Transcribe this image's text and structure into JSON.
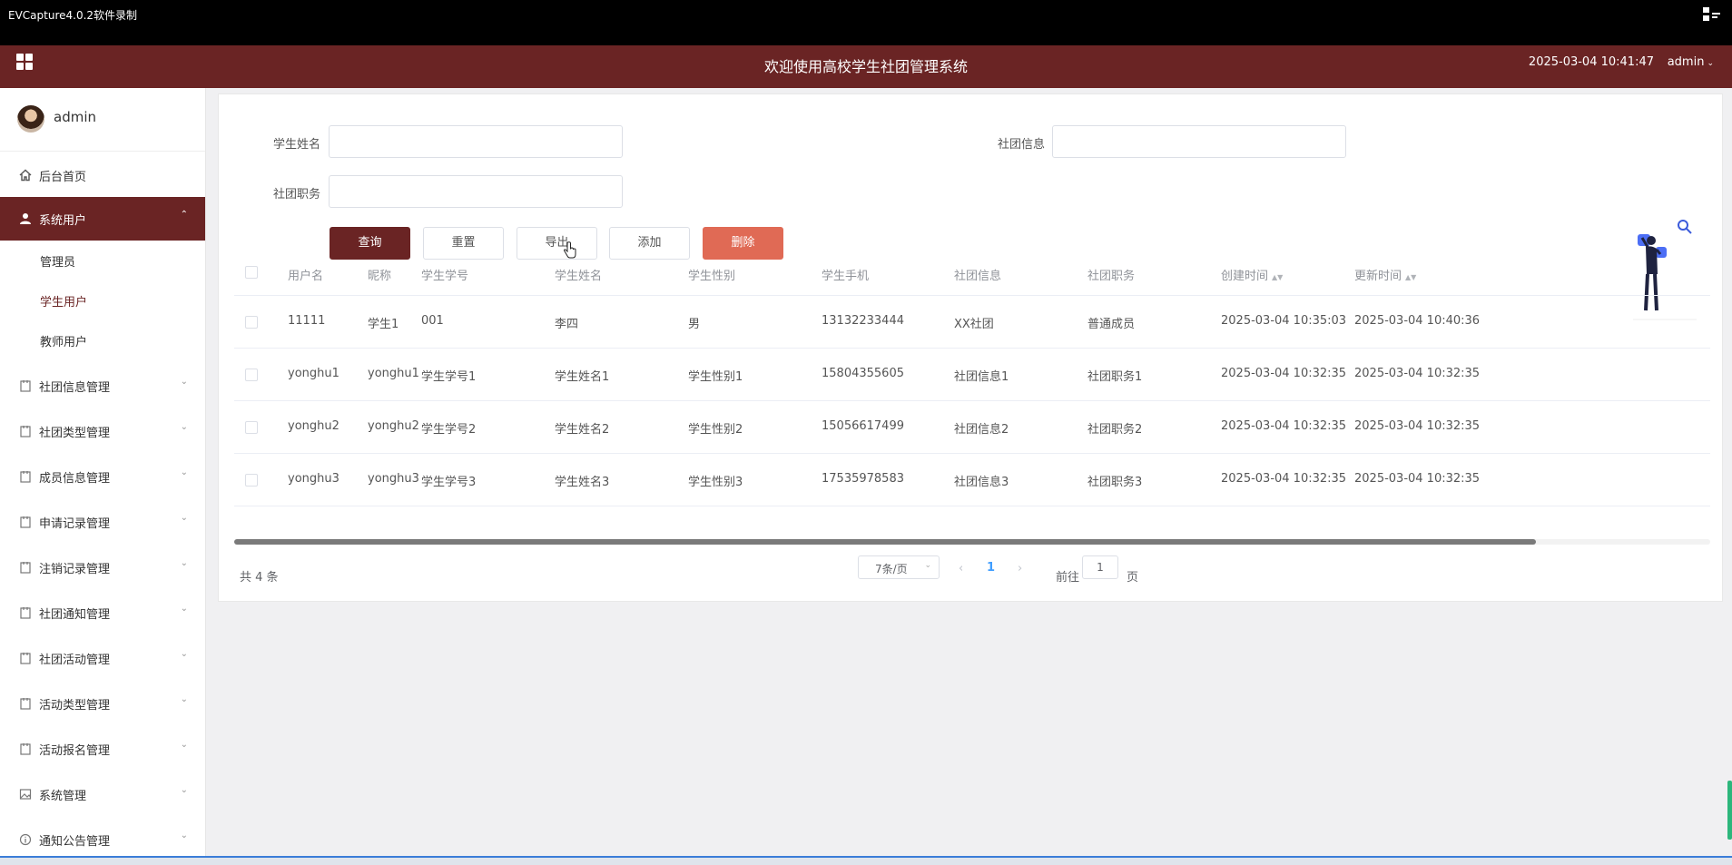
{
  "recorder": {
    "title": "EVCapture4.0.2软件录制",
    "icon": "exit-fullscreen-icon"
  },
  "header": {
    "title": "欢迎使用高校学生社团管理系统",
    "datetime": "2025-03-04 10:41:47",
    "user": "admin",
    "menu_icon": "grid-menu-icon",
    "bg_color": "#6a2424"
  },
  "sidebar": {
    "profile_name": "admin",
    "items": [
      {
        "label": "后台首页",
        "icon": "home-icon"
      },
      {
        "label": "系统用户",
        "icon": "user-icon",
        "active": true
      },
      {
        "label": "社团信息管理",
        "icon": "doc-icon"
      },
      {
        "label": "社团类型管理",
        "icon": "doc-icon"
      },
      {
        "label": "成员信息管理",
        "icon": "doc-icon"
      },
      {
        "label": "申请记录管理",
        "icon": "doc-icon"
      },
      {
        "label": "注销记录管理",
        "icon": "doc-icon"
      },
      {
        "label": "社团通知管理",
        "icon": "doc-icon"
      },
      {
        "label": "社团活动管理",
        "icon": "doc-icon"
      },
      {
        "label": "活动类型管理",
        "icon": "doc-icon"
      },
      {
        "label": "活动报名管理",
        "icon": "doc-icon"
      },
      {
        "label": "系统管理",
        "icon": "image-icon"
      },
      {
        "label": "通知公告管理",
        "icon": "info-icon"
      }
    ],
    "subitems": [
      {
        "label": "管理员"
      },
      {
        "label": "学生用户",
        "current": true
      },
      {
        "label": "教师用户"
      }
    ]
  },
  "search": {
    "name_label": "学生姓名",
    "name_value": "",
    "club_label": "社团信息",
    "club_value": "",
    "role_label": "社团职务",
    "role_value": ""
  },
  "buttons": {
    "query": "查询",
    "reset": "重置",
    "export": "导出",
    "add": "添加",
    "delete": "删除"
  },
  "table": {
    "columns": [
      "用户名",
      "昵称",
      "学生学号",
      "学生姓名",
      "学生性别",
      "学生手机",
      "社团信息",
      "社团职务",
      "创建时间",
      "更新时间"
    ],
    "rows": [
      [
        "11111",
        "学生1",
        "001",
        "李四",
        "男",
        "13132233444",
        "XX社团",
        "普通成员",
        "2025-03-04 10:35:03",
        "2025-03-04 10:40:36"
      ],
      [
        "yonghu1",
        "yonghu1",
        "学生学号1",
        "学生姓名1",
        "学生性别1",
        "15804355605",
        "社团信息1",
        "社团职务1",
        "2025-03-04 10:32:35",
        "2025-03-04 10:32:35"
      ],
      [
        "yonghu2",
        "yonghu2",
        "学生学号2",
        "学生姓名2",
        "学生性别2",
        "15056617499",
        "社团信息2",
        "社团职务2",
        "2025-03-04 10:32:35",
        "2025-03-04 10:32:35"
      ],
      [
        "yonghu3",
        "yonghu3",
        "学生学号3",
        "学生姓名3",
        "学生性别3",
        "17535978583",
        "社团信息3",
        "社团职务3",
        "2025-03-04 10:32:35",
        "2025-03-04 10:32:35"
      ]
    ]
  },
  "pagination": {
    "total": "共 4 条",
    "page_size": "7条/页",
    "current": "1",
    "goto_prefix": "前往",
    "goto_value": "1",
    "goto_suffix": "页"
  }
}
